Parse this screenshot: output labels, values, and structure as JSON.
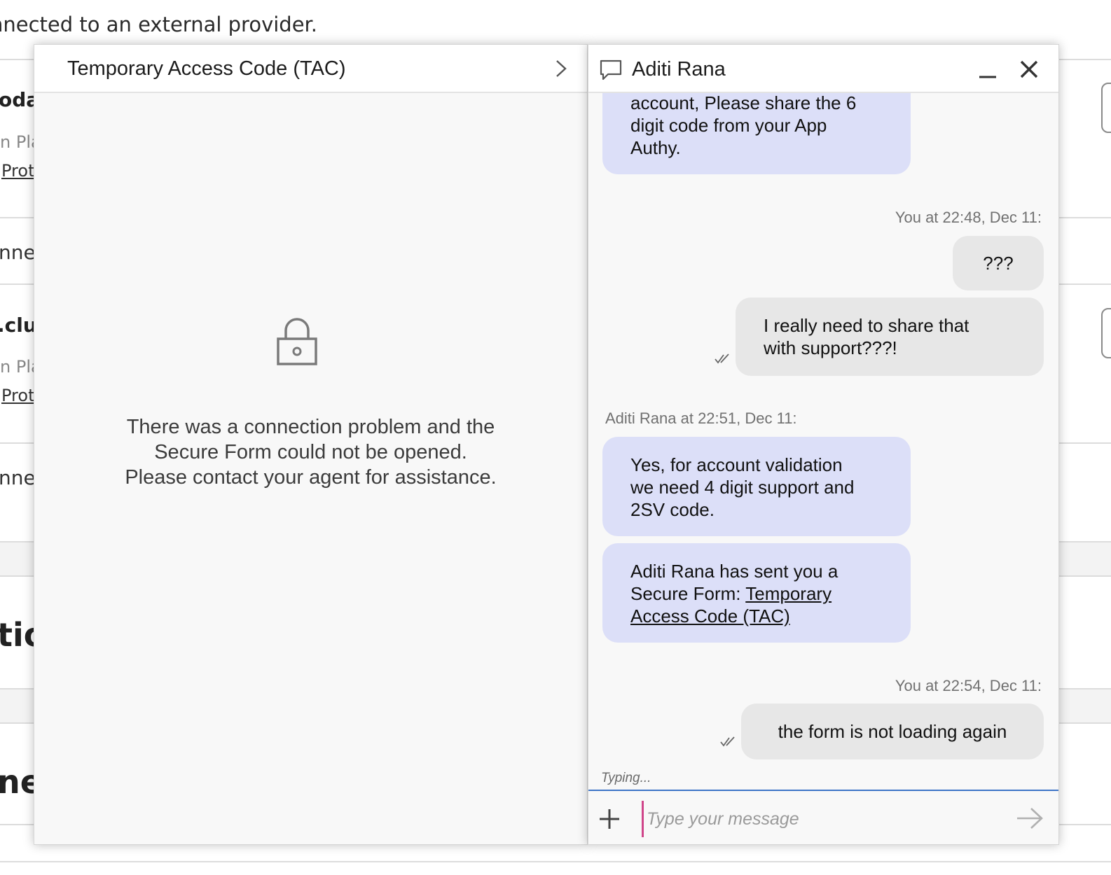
{
  "background": {
    "top_text": "nnected to an external provider.",
    "fragments": {
      "item1_title": "oda",
      "item1_sub": "n Pla",
      "item1_link": "Prot",
      "item1_status": "nne",
      "item2_title": ".clu",
      "item2_sub": "n Pla",
      "item2_link": "Prot",
      "item2_status": "nne",
      "section1_heading": "tio",
      "section2_heading": "ner"
    }
  },
  "form_panel": {
    "title": "Temporary Access Code (TAC)",
    "error_lines": [
      "There was a connection problem and the",
      "Secure Form could not be opened.",
      "Please contact your agent for assistance."
    ]
  },
  "chat": {
    "agent_name": "Aditi Rana",
    "messages": {
      "m1": [
        "account, Please share the 6",
        "digit code from your App",
        "Authy."
      ],
      "meta_you_1": "You at 22:48, Dec 11:",
      "m2": "???",
      "m3": [
        "I really need to share that",
        "with support???!"
      ],
      "meta_agent": "Aditi Rana at 22:51, Dec 11:",
      "m4": [
        "Yes, for account validation",
        "we need 4 digit support and",
        "2SV code."
      ],
      "m5_prefix": [
        "Aditi Rana has sent you a",
        "Secure Form: "
      ],
      "m5_link": [
        "Temporary",
        "Access Code (TAC)"
      ],
      "meta_you_2": "You at 22:54, Dec 11:",
      "m6": "the form is not loading again"
    },
    "typing_indicator": "Typing...",
    "composer": {
      "placeholder": "Type your message",
      "value": ""
    }
  }
}
